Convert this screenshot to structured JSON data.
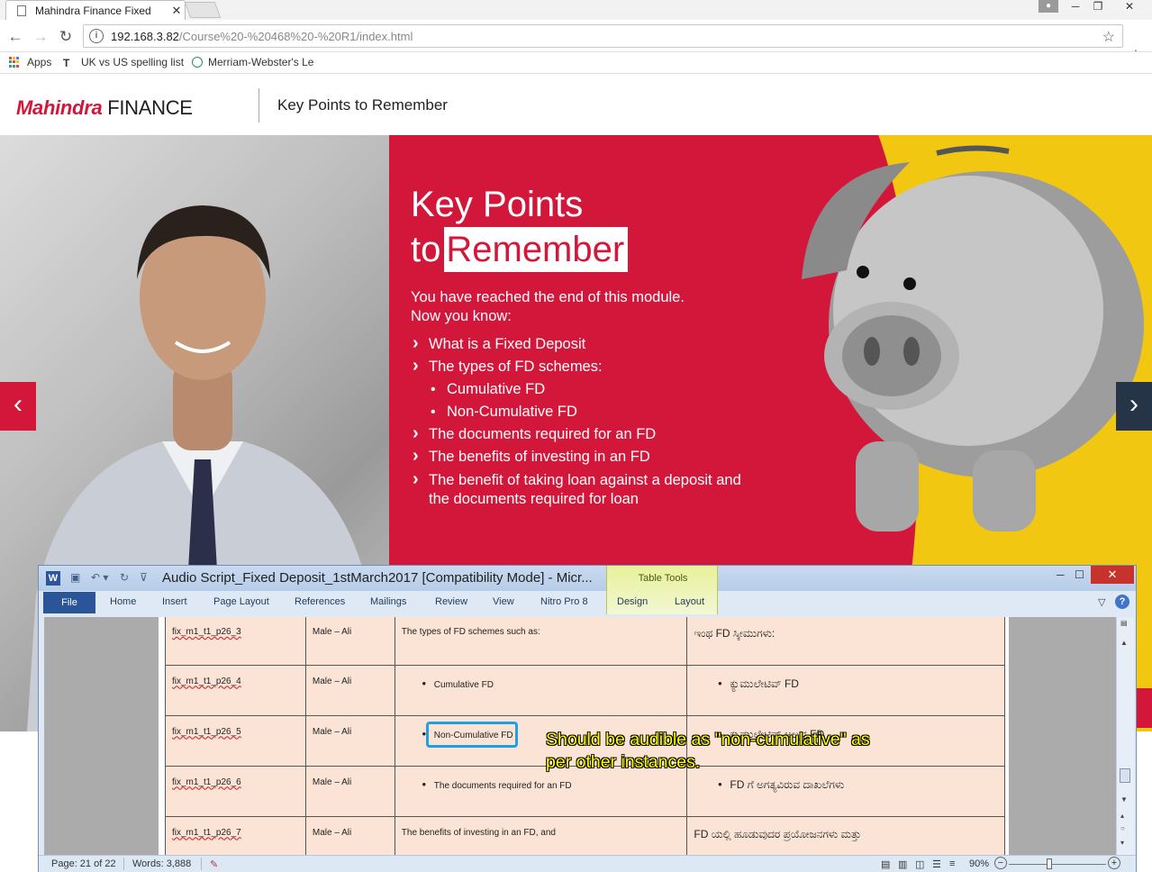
{
  "browser": {
    "tab_title": "Mahindra Finance Fixed",
    "tab_close": "✕",
    "url_host": "192.168.3.82",
    "url_path": "/Course%20-%20468%20-%20R1/index.html",
    "bookmarks": [
      "Apps",
      "UK vs US spelling list",
      "Merriam-Webster's Le"
    ]
  },
  "header": {
    "logo_brand": "Mahindra",
    "logo_suffix": "FINANCE",
    "title": "Key Points to Remember"
  },
  "hero": {
    "title_line1": "Key Points",
    "title_to": "to",
    "title_remember": "Remember",
    "intro_line1": "You have reached the end of this module.",
    "intro_line2": "Now you know:",
    "items": [
      {
        "text": "What is a Fixed Deposit",
        "kind": "chevron"
      },
      {
        "text": "The types of FD schemes:",
        "kind": "chevron"
      },
      {
        "text": "Cumulative FD",
        "kind": "bullet"
      },
      {
        "text": "Non-Cumulative FD",
        "kind": "bullet"
      },
      {
        "text": "The documents required for an FD",
        "kind": "chevron"
      },
      {
        "text": "The benefits of investing in an FD",
        "kind": "chevron"
      },
      {
        "text": "The benefit of taking loan against a deposit and",
        "kind": "chevron"
      },
      {
        "text": "the documents required for loan",
        "kind": "continuation"
      }
    ],
    "prev_label": "‹",
    "next_label": "›",
    "colors": {
      "red": "#d3173a",
      "yellow": "#f2c712",
      "navy": "#253446"
    }
  },
  "word": {
    "doc_title": "Audio Script_Fixed Deposit_1stMarch2017 [Compatibility Mode]  -  Micr...",
    "table_tools": "Table Tools",
    "close_label": "✕",
    "ribbon_tabs": [
      "File",
      "Home",
      "Insert",
      "Page Layout",
      "References",
      "Mailings",
      "Review",
      "View",
      "Nitro Pro 8",
      "Design",
      "Layout"
    ],
    "rows": [
      {
        "code": "fix_m1_t1_p26_3",
        "voice": "Male – Ali",
        "english": "The types of FD schemes such as:",
        "bullet_en": false,
        "kannada": "ಇಂಥ FD ಸ್ಕೀಮುಗಳು:",
        "bullet_kn": false
      },
      {
        "code": "fix_m1_t1_p26_4",
        "voice": "Male – Ali",
        "english": "Cumulative FD",
        "bullet_en": true,
        "kannada": "ಕ್ಯುಮುಲೇಟಿವ್ FD",
        "bullet_kn": true
      },
      {
        "code": "fix_m1_t1_p26_5",
        "voice": "Male – Ali",
        "english": "Non-Cumulative FD",
        "bullet_en": true,
        "kannada": "ಕ್ಯುಮುಲೇಟಿವ್ ಅಲ್ಲದ FD",
        "bullet_kn": true
      },
      {
        "code": "fix_m1_t1_p26_6",
        "voice": "Male – Ali",
        "english": "The documents required for an FD",
        "bullet_en": true,
        "kannada": "FD ಗೆ ಅಗತ್ಯವಿರುವ ದಾಖಲೆಗಳು",
        "bullet_kn": true
      },
      {
        "code": "fix_m1_t1_p26_7",
        "voice": "Male – Ali",
        "english": "The benefits of investing in an FD, and",
        "bullet_en": false,
        "kannada": "FD ಯಲ್ಲಿ ಹೂಡುವುದರ ಪ್ರಯೋಜನಗಳು ಮತ್ತು",
        "bullet_kn": false
      }
    ],
    "annotation": "Should be audible as \"non-cumulative\" as per other instances.",
    "status_page": "Page: 21 of 22",
    "status_words": "Words: 3,888",
    "zoom": "90%"
  }
}
